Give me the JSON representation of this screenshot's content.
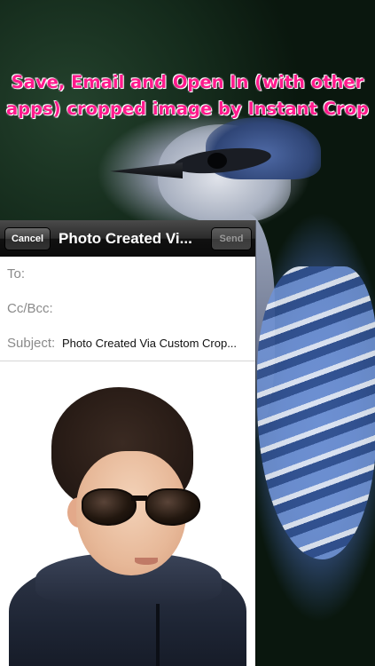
{
  "headline": {
    "line1": "Save, Email and Open In (with other",
    "line2": "apps) cropped image by Instant Crop",
    "color": "#ff1a8c"
  },
  "navbar": {
    "cancel_label": "Cancel",
    "title": "Photo Created Vi...",
    "send_label": "Send"
  },
  "fields": {
    "to_label": "To:",
    "to_value": "",
    "cc_label": "Cc/Bcc:",
    "cc_value": "",
    "subject_label": "Subject:",
    "subject_value": "Photo Created Via Custom Crop..."
  },
  "attachment": {
    "type": "image"
  }
}
